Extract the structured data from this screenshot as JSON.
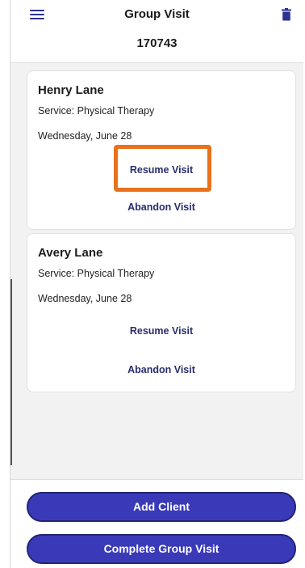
{
  "header": {
    "title": "Group Visit",
    "visit_id": "170743",
    "menu_icon": "hamburger-menu-icon",
    "delete_icon": "trash-icon"
  },
  "clients": [
    {
      "name": "Henry Lane",
      "service": "Service: Physical Therapy",
      "date": "Wednesday, June 28",
      "resume_label": "Resume Visit",
      "abandon_label": "Abandon Visit"
    },
    {
      "name": "Avery Lane",
      "service": "Service: Physical Therapy",
      "date": "Wednesday, June 28",
      "resume_label": "Resume Visit",
      "abandon_label": "Abandon Visit"
    }
  ],
  "footer": {
    "add_client_label": "Add Client",
    "complete_label": "Complete Group Visit"
  },
  "colors": {
    "accent": "#3a3ab8",
    "link": "#2a2d6e",
    "highlight": "#e8711b",
    "background": "#f2f2f2"
  }
}
